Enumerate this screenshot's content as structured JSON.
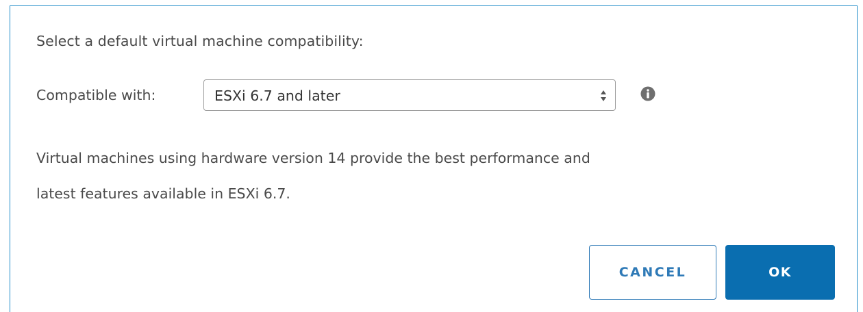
{
  "dialog": {
    "prompt": "Select a default virtual machine compatibility:",
    "compatibility": {
      "label": "Compatible with:",
      "selected_value": "ESXi 6.7 and later",
      "info_icon": "info-circle-icon"
    },
    "description": {
      "line1": "Virtual machines using hardware version 14 provide the best performance and",
      "line2": "latest features available in ESXi 6.7."
    },
    "buttons": {
      "cancel_label": "CANCEL",
      "ok_label": "OK"
    }
  },
  "colors": {
    "border_accent": "#1d8ac8",
    "primary_button": "#0a6eb0",
    "secondary_button_text": "#2f7ab7",
    "text": "#4a4a4a"
  }
}
